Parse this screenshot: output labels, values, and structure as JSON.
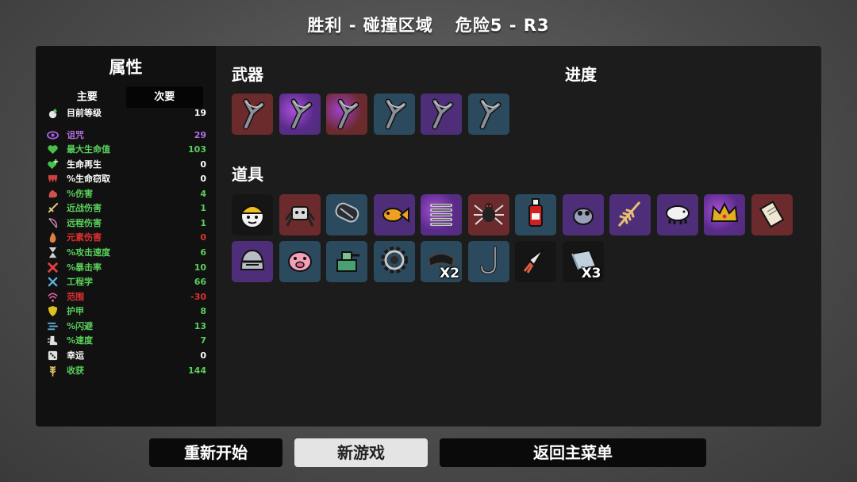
{
  "header": {
    "result": "胜利 - 碰撞区域",
    "danger": "危险5 - R3"
  },
  "stats": {
    "title": "属性",
    "tab_primary": "主要",
    "tab_secondary": "次要",
    "rows": [
      {
        "icon": "level-up-icon",
        "label": "目前等级",
        "value": "19",
        "color": "#ffffff",
        "icon_color": "#e6e6e6"
      },
      {
        "icon": "curse-eye-icon",
        "label": "诅咒",
        "value": "29",
        "color": "#b26ce0",
        "icon_color": "#a55ce0"
      },
      {
        "icon": "heart-icon",
        "label": "最大生命值",
        "value": "103",
        "color": "#59d15a",
        "icon_color": "#48c04a"
      },
      {
        "icon": "heart-plus-icon",
        "label": "生命再生",
        "value": "0",
        "color": "#ffffff",
        "icon_color": "#48c04a"
      },
      {
        "icon": "fangs-icon",
        "label": "%生命窃取",
        "value": "0",
        "color": "#ffffff",
        "icon_color": "#d04040"
      },
      {
        "icon": "muscle-icon",
        "label": "%伤害",
        "value": "4",
        "color": "#59d15a",
        "icon_color": "#d05050"
      },
      {
        "icon": "sword-icon",
        "label": "近战伤害",
        "value": "1",
        "color": "#59d15a",
        "icon_color": "#e0c080"
      },
      {
        "icon": "bow-icon",
        "label": "远程伤害",
        "value": "1",
        "color": "#59d15a",
        "icon_color": "#d060a0"
      },
      {
        "icon": "flame-icon",
        "label": "元素伤害",
        "value": "0",
        "color": "#e03030",
        "icon_color": "#e08040"
      },
      {
        "icon": "hourglass-icon",
        "label": "%攻击速度",
        "value": "6",
        "color": "#59d15a",
        "icon_color": "#d0d0d0"
      },
      {
        "icon": "crit-icon",
        "label": "%暴击率",
        "value": "10",
        "color": "#59d15a",
        "icon_color": "#e04040"
      },
      {
        "icon": "wrench-icon",
        "label": "工程学",
        "value": "66",
        "color": "#59d15a",
        "icon_color": "#60b0e0"
      },
      {
        "icon": "range-icon",
        "label": "范围",
        "value": "-30",
        "color": "#e03030",
        "icon_color": "#e060a0"
      },
      {
        "icon": "shield-icon",
        "label": "护甲",
        "value": "8",
        "color": "#59d15a",
        "icon_color": "#e0c020"
      },
      {
        "icon": "dodge-icon",
        "label": "%闪避",
        "value": "13",
        "color": "#59d15a",
        "icon_color": "#60b0e0"
      },
      {
        "icon": "speed-boot-icon",
        "label": "%速度",
        "value": "7",
        "color": "#59d15a",
        "icon_color": "#e0e0e0"
      },
      {
        "icon": "dice-icon",
        "label": "幸运",
        "value": "0",
        "color": "#ffffff",
        "icon_color": "#e0e0e0"
      },
      {
        "icon": "wheat-icon",
        "label": "收获",
        "value": "144",
        "color": "#59d15a",
        "icon_color": "#e0c060"
      }
    ]
  },
  "weapons": {
    "title": "武器",
    "progress_title": "进度",
    "items": [
      {
        "name": "slingshot-icon",
        "tier": "red"
      },
      {
        "name": "slingshot-icon",
        "tier": "purple-fx"
      },
      {
        "name": "slingshot-icon",
        "tier": "red-fx"
      },
      {
        "name": "slingshot-icon",
        "tier": "blue"
      },
      {
        "name": "slingshot-icon",
        "tier": "purple"
      },
      {
        "name": "slingshot-icon",
        "tier": "blue"
      }
    ]
  },
  "items": {
    "title": "道具",
    "list": [
      {
        "name": "helmet-face-icon",
        "tier": "black",
        "count": ""
      },
      {
        "name": "robot-spider-icon",
        "tier": "red",
        "count": ""
      },
      {
        "name": "tube-icon",
        "tier": "blue",
        "count": ""
      },
      {
        "name": "goldfish-icon",
        "tier": "purple",
        "count": ""
      },
      {
        "name": "spring-icon",
        "tier": "purple-fx",
        "count": ""
      },
      {
        "name": "spider-icon",
        "tier": "red",
        "count": ""
      },
      {
        "name": "ketchup-icon",
        "tier": "blue",
        "count": ""
      },
      {
        "name": "alien-eyes-icon",
        "tier": "purple",
        "count": ""
      },
      {
        "name": "wheat-icon",
        "tier": "purple",
        "count": ""
      },
      {
        "name": "tardigrade-icon",
        "tier": "purple",
        "count": ""
      },
      {
        "name": "crown-icon",
        "tier": "purple-fx",
        "count": ""
      },
      {
        "name": "scroll-icon",
        "tier": "red",
        "count": ""
      },
      {
        "name": "knight-helmet-icon",
        "tier": "purple",
        "count": ""
      },
      {
        "name": "piggy-bank-icon",
        "tier": "blue",
        "count": ""
      },
      {
        "name": "turret-icon",
        "tier": "blue",
        "count": ""
      },
      {
        "name": "gear-icon",
        "tier": "blue",
        "count": ""
      },
      {
        "name": "scarf-icon",
        "tier": "blue",
        "count": "X2"
      },
      {
        "name": "hook-icon",
        "tier": "blue",
        "count": ""
      },
      {
        "name": "rocket-icon",
        "tier": "black",
        "count": ""
      },
      {
        "name": "material-bar-icon",
        "tier": "black",
        "count": "X3"
      }
    ]
  },
  "buttons": {
    "restart": "重新开始",
    "new_game": "新游戏",
    "main_menu": "返回主菜单"
  }
}
